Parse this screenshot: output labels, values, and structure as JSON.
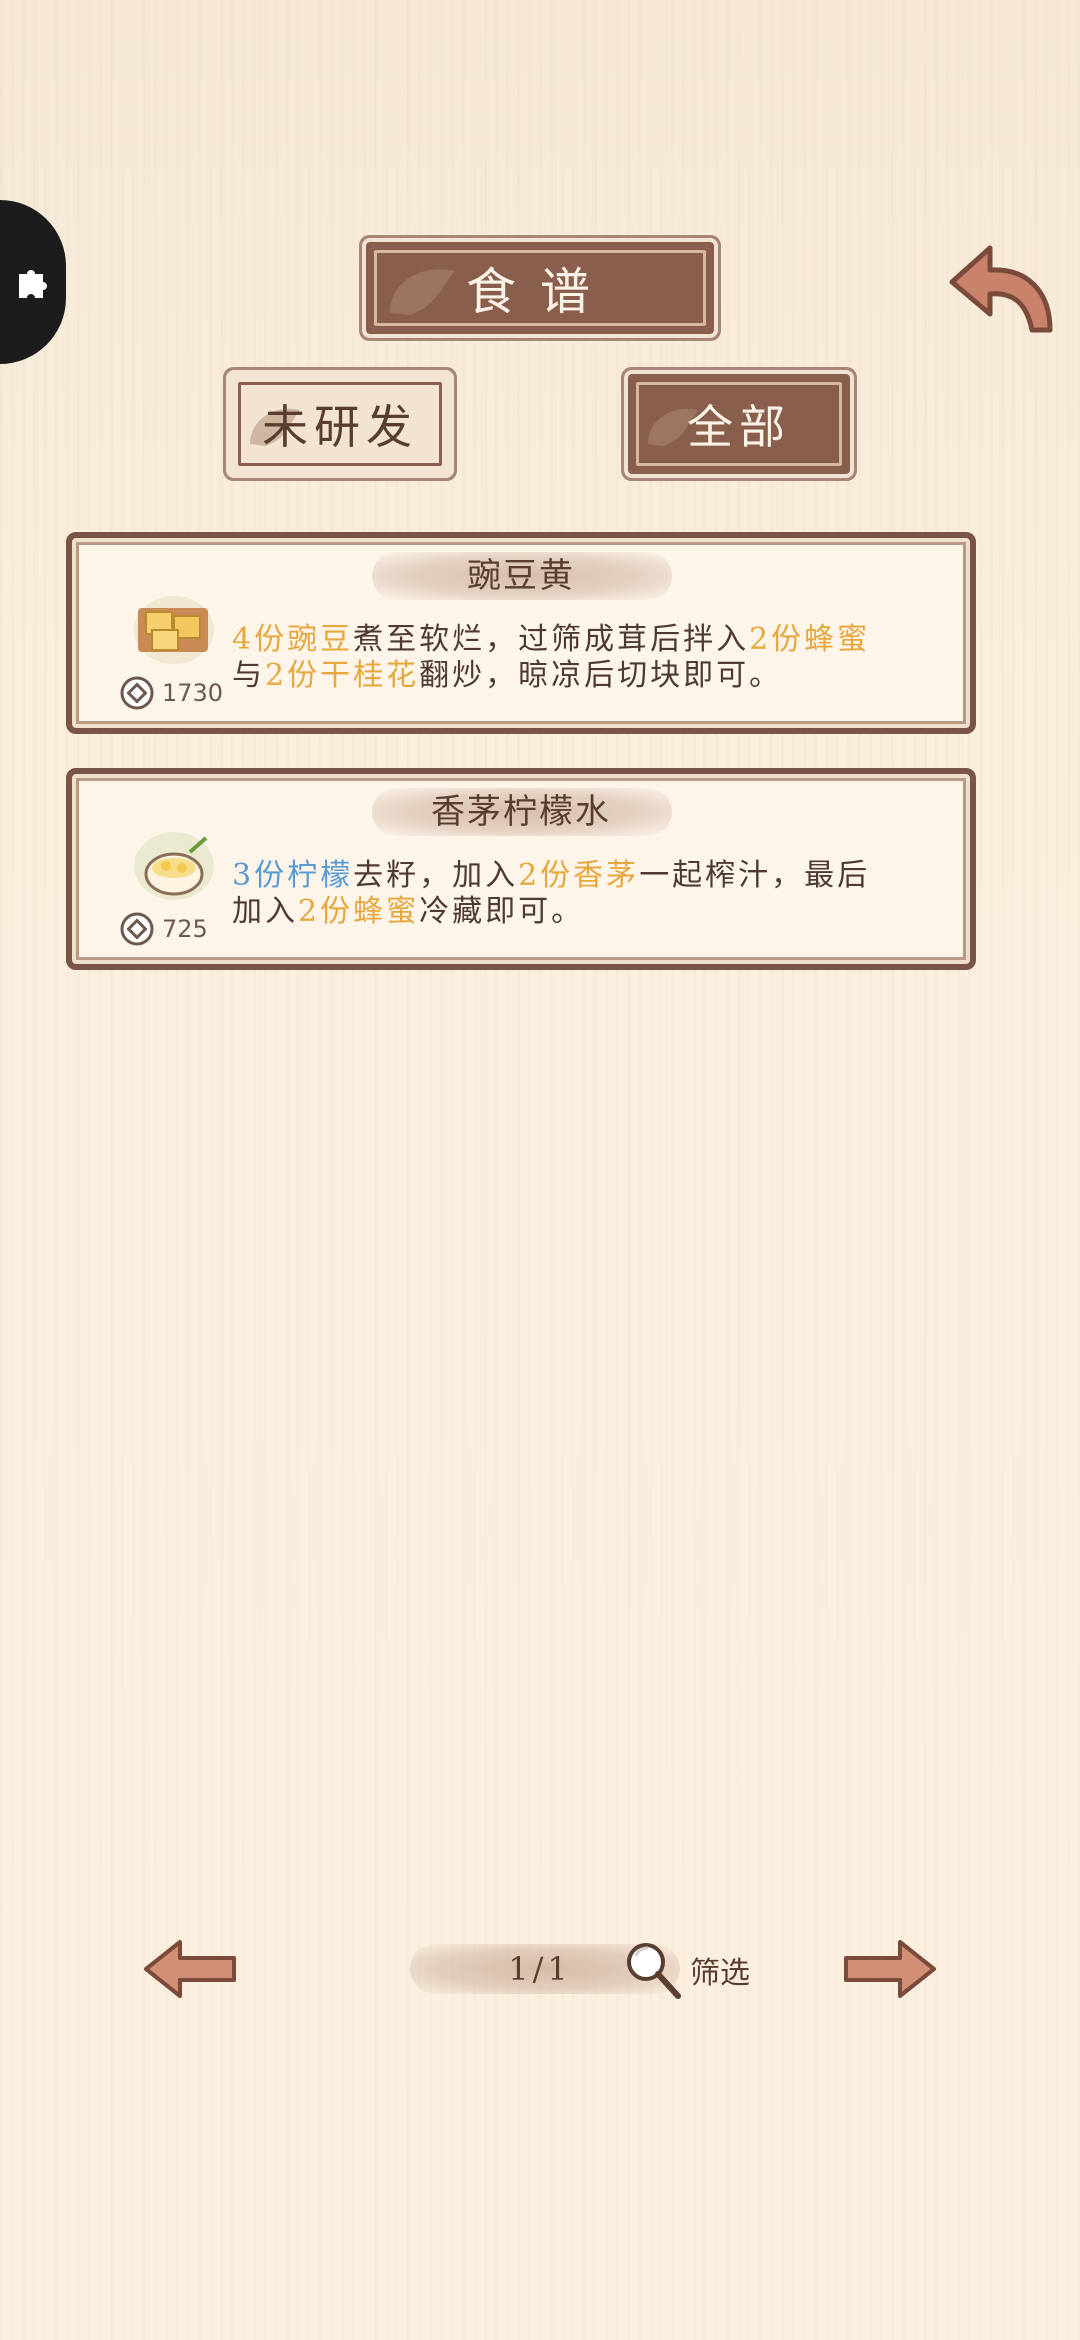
{
  "header": {
    "title": "食谱"
  },
  "tabs": [
    {
      "label": "未研发",
      "active": false
    },
    {
      "label": "全部",
      "active": true
    }
  ],
  "recipes": [
    {
      "name": "豌豆黄",
      "price": "1730",
      "icon": "pea-cake-icon",
      "line1": [
        {
          "t": "4份豌豆",
          "c": "y"
        },
        {
          "t": "煮至软烂，过筛成茸后拌入",
          "c": ""
        },
        {
          "t": "2份蜂蜜",
          "c": "y"
        }
      ],
      "line2": [
        {
          "t": "与",
          "c": ""
        },
        {
          "t": "2份干桂花",
          "c": "y"
        },
        {
          "t": "翻炒，晾凉后切块即可。",
          "c": ""
        }
      ]
    },
    {
      "name": "香茅柠檬水",
      "price": "725",
      "icon": "lemon-drink-icon",
      "line1": [
        {
          "t": "3份柠檬",
          "c": "b"
        },
        {
          "t": "去籽，加入",
          "c": ""
        },
        {
          "t": "2份香茅",
          "c": "y"
        },
        {
          "t": "一起榨汁，最后",
          "c": ""
        }
      ],
      "line2": [
        {
          "t": "加入",
          "c": ""
        },
        {
          "t": "2份蜂蜜",
          "c": "y"
        },
        {
          "t": "冷藏即可。",
          "c": ""
        }
      ]
    }
  ],
  "pager": {
    "page": "1/1",
    "filter_label": "筛选"
  },
  "colors": {
    "plank": "#8a5e4d",
    "highlight": "#e6a83c",
    "lemon": "#5b9ad0",
    "text": "#4e3a32"
  }
}
